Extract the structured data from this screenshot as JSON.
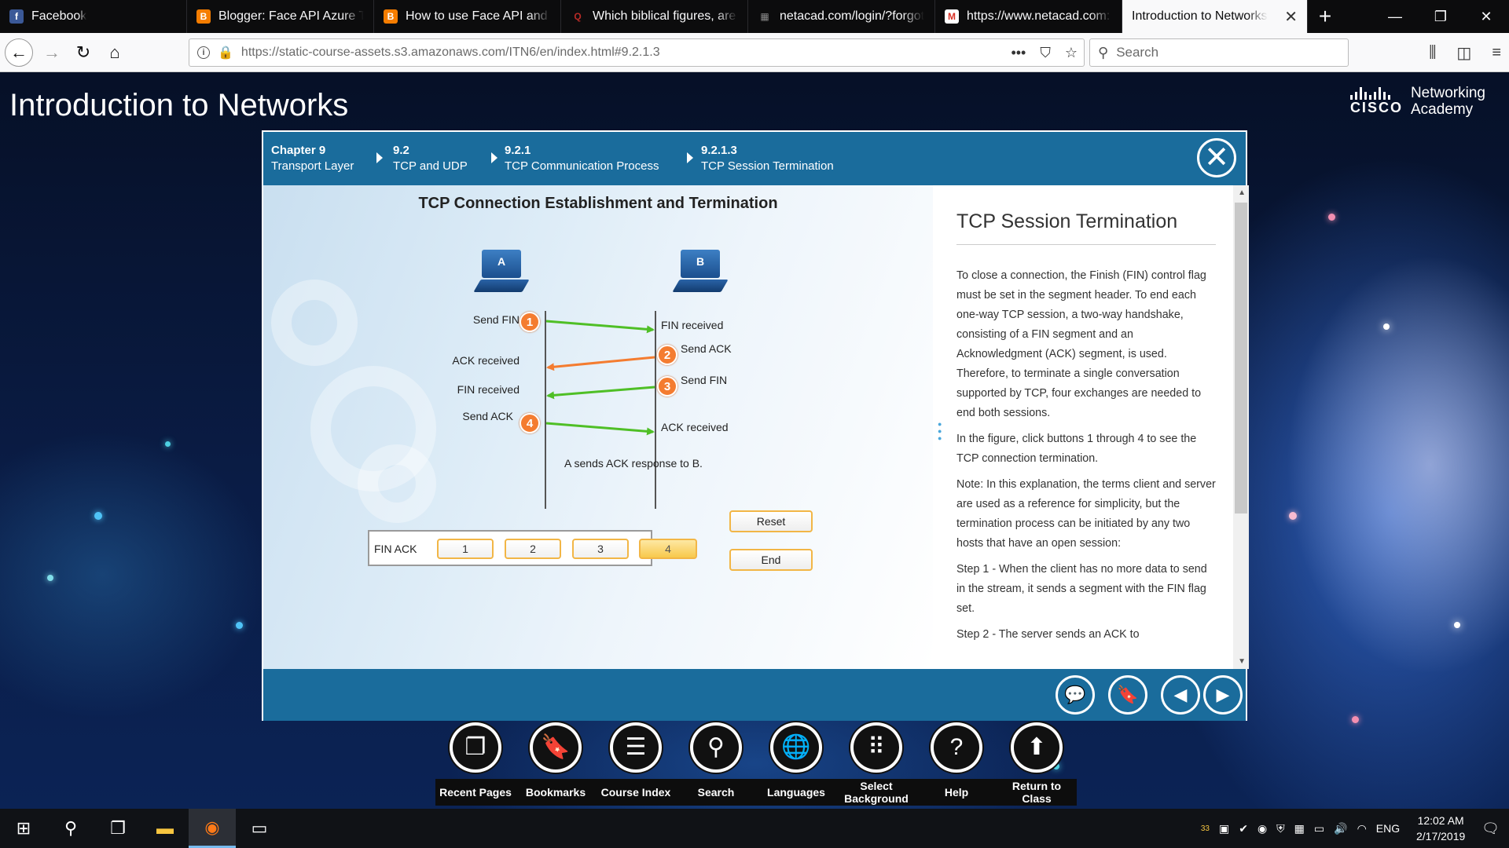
{
  "browser": {
    "tabs": [
      {
        "label": "Facebook",
        "icon": "facebook-icon",
        "color": "#3b5998",
        "glyph": "f"
      },
      {
        "label": "Blogger: Face API Azure Tec",
        "icon": "blogger-icon",
        "color": "#f57d00",
        "glyph": "B"
      },
      {
        "label": "How to use Face API and ut",
        "icon": "blogger-icon",
        "color": "#f57d00",
        "glyph": "B"
      },
      {
        "label": "Which biblical figures, are M",
        "icon": "quora-icon",
        "color": "#b92b27",
        "glyph": "Q"
      },
      {
        "label": "netacad.com/login/?forgot",
        "icon": "page-icon",
        "color": "#555555",
        "glyph": "▦"
      },
      {
        "label": "https://www.netacad.com: R",
        "icon": "gmail-icon",
        "color": "#d93025",
        "glyph": "M"
      },
      {
        "label": "Introduction to Networks",
        "icon": "",
        "color": "",
        "glyph": ""
      }
    ],
    "url_main": "https://static-course-assets.s3.amazonaws.com",
    "url_rest": "/ITN6/en/index.html#9.2.1.3",
    "search_placeholder": "Search"
  },
  "course": {
    "title": "Introduction to Networks",
    "brand_word": "CISCO",
    "brand_line1": "Networking",
    "brand_line2": "Academy"
  },
  "breadcrumb": [
    {
      "num": "Chapter 9",
      "title": "Transport Layer"
    },
    {
      "num": "9.2",
      "title": "TCP and UDP"
    },
    {
      "num": "9.2.1",
      "title": "TCP Communication Process"
    },
    {
      "num": "9.2.1.3",
      "title": "TCP Session Termination"
    }
  ],
  "figure": {
    "title": "TCP Connection Establishment and Termination",
    "host_a": "A",
    "host_b": "B",
    "labels_a": [
      "Send FIN",
      "ACK received",
      "FIN received",
      "Send ACK"
    ],
    "labels_b": [
      "FIN received",
      "Send ACK",
      "Send FIN",
      "ACK received"
    ],
    "steps": [
      "1",
      "2",
      "3",
      "4"
    ],
    "caption": "A sends ACK response to B.",
    "control_label": "FIN ACK",
    "buttons": [
      "1",
      "2",
      "3",
      "4"
    ],
    "selected_button": "4",
    "reset_label": "Reset",
    "end_label": "End",
    "colors": {
      "green": "#4fbf26",
      "orange": "#f47c30"
    }
  },
  "text": {
    "heading": "TCP Session Termination",
    "p1": "To close a connection, the Finish (FIN) control flag must be set in the segment header. To end each one-way TCP session, a two-way handshake, consisting of a FIN segment and an Acknowledgment (ACK) segment, is used. Therefore, to terminate a single conversation supported by TCP, four exchanges are needed to end both sessions.",
    "p2": "In the figure, click buttons 1 through 4 to see the TCP connection termination.",
    "note_label": "Note",
    "p3": ": In this explanation, the terms client and server are used as a reference for simplicity, but the termination process can be initiated by any two hosts that have an open session:",
    "step1_label": "Step 1",
    "step1": " - When the client has no more data to send in the stream, it sends a segment with the FIN flag set.",
    "step2_label": "Step 2",
    "step2": " - The server sends an ACK to"
  },
  "course_nav": [
    {
      "label": "Recent Pages",
      "icon": "recent-pages-icon",
      "glyph": "❐"
    },
    {
      "label": "Bookmarks",
      "icon": "bookmarks-icon",
      "glyph": "🔖"
    },
    {
      "label": "Course Index",
      "icon": "course-index-icon",
      "glyph": "☰"
    },
    {
      "label": "Search",
      "icon": "search-icon",
      "glyph": "⚲"
    },
    {
      "label": "Languages",
      "icon": "languages-icon",
      "glyph": "🌐"
    },
    {
      "label": "Select Background",
      "icon": "select-background-icon",
      "glyph": "⠿"
    },
    {
      "label": "Help",
      "icon": "help-icon",
      "glyph": "?"
    },
    {
      "label": "Return to Class",
      "icon": "return-to-class-icon",
      "glyph": "⬆"
    }
  ],
  "taskbar": {
    "tray_badge": "33",
    "language": "ENG",
    "time": "12:02 AM",
    "date": "2/17/2019",
    "notifications": "1"
  }
}
